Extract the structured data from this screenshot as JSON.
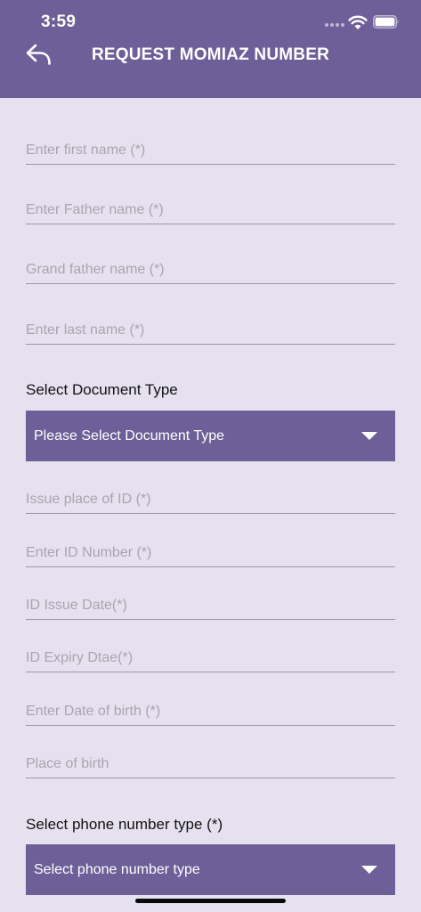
{
  "status_bar": {
    "time": "3:59"
  },
  "header": {
    "title": "REQUEST MOMIAZ NUMBER",
    "back_icon": "reply-arrow-icon",
    "background": "#6f5f98"
  },
  "form": {
    "first_name_placeholder": "Enter first name (*)",
    "father_name_placeholder": "Enter Father name (*)",
    "grandfather_name_placeholder": "Grand father name (*)",
    "last_name_placeholder": "Enter last name (*)",
    "document_type_label": "Select Document Type",
    "document_type_value": "Please Select Document Type",
    "issue_place_placeholder": "Issue place of ID (*)",
    "id_number_placeholder": "Enter ID Number (*)",
    "id_issue_date_placeholder": "ID Issue Date(*)",
    "id_expiry_date_placeholder": "ID Expiry Dtae(*)",
    "date_of_birth_placeholder": "Enter Date of birth (*)",
    "place_of_birth_placeholder": "Place of birth",
    "phone_type_label": "Select phone number  type (*)",
    "phone_type_value": "Select phone  number type"
  },
  "colors": {
    "accent": "#6f5f98",
    "page_background": "#e6e1ee"
  }
}
